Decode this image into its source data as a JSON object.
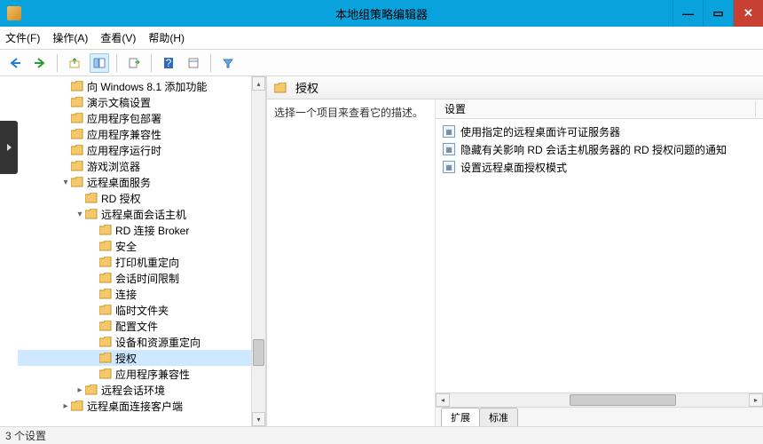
{
  "window": {
    "title": "本地组策略编辑器"
  },
  "menubar": [
    {
      "label": "文件(F)"
    },
    {
      "label": "操作(A)"
    },
    {
      "label": "查看(V)"
    },
    {
      "label": "帮助(H)"
    }
  ],
  "tree": {
    "items": [
      {
        "depth": 3,
        "label": "向 Windows 8.1 添加功能",
        "exp": ""
      },
      {
        "depth": 3,
        "label": "演示文稿设置",
        "exp": ""
      },
      {
        "depth": 3,
        "label": "应用程序包部署",
        "exp": ""
      },
      {
        "depth": 3,
        "label": "应用程序兼容性",
        "exp": ""
      },
      {
        "depth": 3,
        "label": "应用程序运行时",
        "exp": ""
      },
      {
        "depth": 3,
        "label": "游戏浏览器",
        "exp": ""
      },
      {
        "depth": 3,
        "label": "远程桌面服务",
        "exp": "▾"
      },
      {
        "depth": 4,
        "label": "RD 授权",
        "exp": ""
      },
      {
        "depth": 4,
        "label": "远程桌面会话主机",
        "exp": "▾"
      },
      {
        "depth": 5,
        "label": "RD 连接 Broker",
        "exp": ""
      },
      {
        "depth": 5,
        "label": "安全",
        "exp": ""
      },
      {
        "depth": 5,
        "label": "打印机重定向",
        "exp": ""
      },
      {
        "depth": 5,
        "label": "会话时间限制",
        "exp": ""
      },
      {
        "depth": 5,
        "label": "连接",
        "exp": ""
      },
      {
        "depth": 5,
        "label": "临时文件夹",
        "exp": ""
      },
      {
        "depth": 5,
        "label": "配置文件",
        "exp": ""
      },
      {
        "depth": 5,
        "label": "设备和资源重定向",
        "exp": ""
      },
      {
        "depth": 5,
        "label": "授权",
        "exp": "",
        "selected": true
      },
      {
        "depth": 5,
        "label": "应用程序兼容性",
        "exp": ""
      },
      {
        "depth": 4,
        "label": "远程会话环境",
        "exp": "▸"
      },
      {
        "depth": 3,
        "label": "远程桌面连接客户端",
        "exp": "▸"
      }
    ]
  },
  "content": {
    "header_title": "授权",
    "description": "选择一个项目来查看它的描述。",
    "column_header": "设置",
    "items": [
      {
        "label": "使用指定的远程桌面许可证服务器"
      },
      {
        "label": "隐藏有关影响 RD 会话主机服务器的 RD 授权问题的通知"
      },
      {
        "label": "设置远程桌面授权模式"
      }
    ],
    "tabs": [
      {
        "label": "扩展",
        "active": true
      },
      {
        "label": "标准",
        "active": false
      }
    ]
  },
  "statusbar": {
    "text": "3 个设置"
  }
}
